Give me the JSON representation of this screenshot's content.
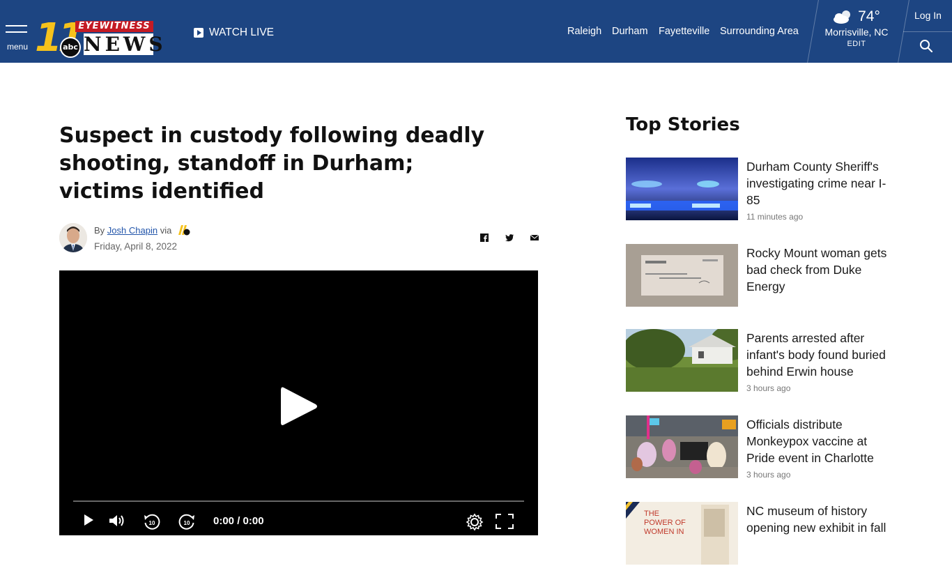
{
  "header": {
    "menu_label": "menu",
    "logo": {
      "number": "11",
      "network": "abc",
      "eyewitness": "EYEWITNESS",
      "news": "NEWS"
    },
    "watch_live": "WATCH LIVE",
    "nav": [
      "Raleigh",
      "Durham",
      "Fayetteville",
      "Surrounding Area"
    ],
    "weather": {
      "temp": "74°",
      "location": "Morrisville, NC",
      "edit": "EDIT",
      "icon": "partly-cloudy-icon"
    },
    "login": "Log In",
    "search_icon": "search-icon"
  },
  "article": {
    "headline": "Suspect in custody following deadly shooting, standoff in Durham; victims identified",
    "by": "By",
    "author": "Josh Chapin",
    "via": "via",
    "date": "Friday, April 8, 2022",
    "share_icons": [
      "facebook-icon",
      "twitter-icon",
      "email-icon"
    ]
  },
  "video": {
    "time": "0:00 / 0:00",
    "rewind_seconds": "10",
    "forward_seconds": "10"
  },
  "top_stories": {
    "title": "Top Stories",
    "items": [
      {
        "title": "Durham County Sheriff's investigating crime near I-85",
        "ago": "11 minutes ago"
      },
      {
        "title": "Rocky Mount woman gets bad check from Duke Energy",
        "ago": ""
      },
      {
        "title": "Parents arrested after infant's body found buried behind Erwin house",
        "ago": "3 hours ago"
      },
      {
        "title": "Officials distribute Monkeypox vaccine at Pride event in Charlotte",
        "ago": "3 hours ago"
      },
      {
        "title": "NC museum of history opening new exhibit in fall",
        "ago": ""
      }
    ],
    "thumb5_text": "THE POWER OF WOMEN IN"
  },
  "colors": {
    "header_bg": "#1d4582",
    "link": "#2255aa"
  }
}
